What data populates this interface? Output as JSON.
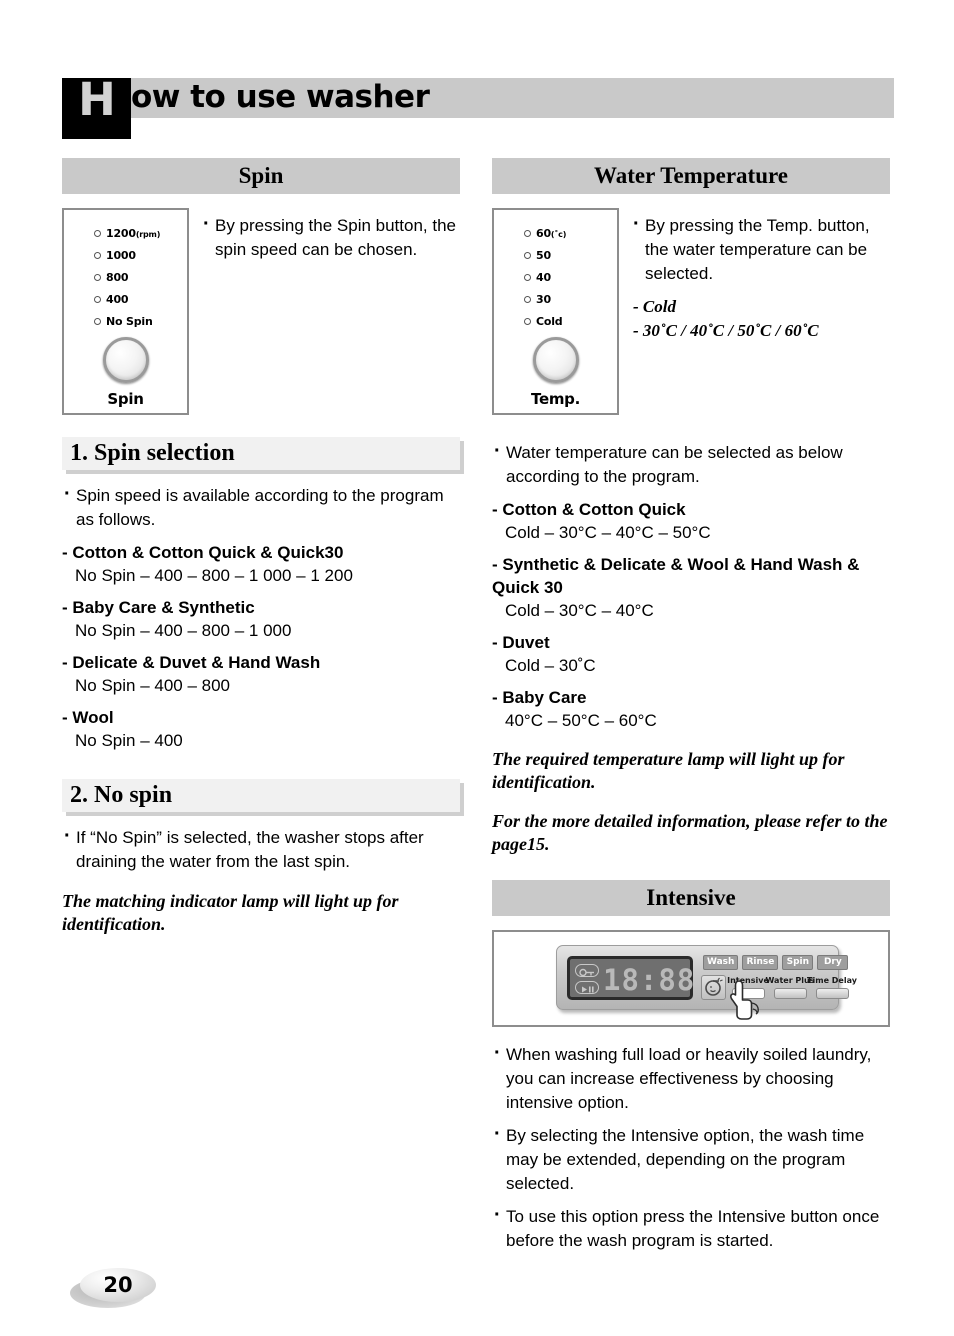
{
  "header": {
    "dropcap": "H",
    "title": "ow to use washer"
  },
  "left_column": {
    "spin_section": {
      "bar_title": "Spin",
      "panel": {
        "leds": [
          {
            "label": "1200",
            "unit": "(rpm)"
          },
          {
            "label": "1000",
            "unit": ""
          },
          {
            "label": "800",
            "unit": ""
          },
          {
            "label": "400",
            "unit": ""
          },
          {
            "label": "No Spin",
            "unit": ""
          }
        ],
        "knob_label": "Spin"
      },
      "note": "By pressing the Spin button, the spin speed can be chosen."
    },
    "heading_1": "1. Spin selection",
    "spin_selection": {
      "bullet": "Spin speed is available according to the program as follows.",
      "items": [
        {
          "title": "Cotton & Cotton Quick & Quick30",
          "value": "No Spin – 400 – 800 – 1 000 – 1 200"
        },
        {
          "title": "Baby Care & Synthetic",
          "value": "No Spin – 400 – 800 – 1 000"
        },
        {
          "title": "Delicate & Duvet & Hand Wash",
          "value": "No Spin – 400 – 800"
        },
        {
          "title": "Wool",
          "value": "No Spin – 400"
        }
      ]
    },
    "heading_2": "2. No spin",
    "no_spin": {
      "bullet": "If “No Spin” is selected, the washer stops after draining the water from the last spin.",
      "italic_note": "The matching indicator lamp will light up for identification."
    }
  },
  "right_column": {
    "temp_section": {
      "bar_title": "Water Temperature",
      "panel": {
        "leds": [
          {
            "label": "60",
            "unit": "(˚c)"
          },
          {
            "label": "50",
            "unit": ""
          },
          {
            "label": "40",
            "unit": ""
          },
          {
            "label": "30",
            "unit": ""
          },
          {
            "label": "Cold",
            "unit": ""
          }
        ],
        "knob_label": "Temp."
      },
      "note": "By pressing the Temp. button, the water temperature can be selected.",
      "options": [
        "Cold",
        "30˚C / 40˚C / 50˚C / 60˚C"
      ]
    },
    "temp_selection": {
      "bullet": "Water temperature can be selected as below according to the program.",
      "items": [
        {
          "title": "Cotton & Cotton Quick",
          "value": "Cold – 30°C – 40°C – 50°C"
        },
        {
          "title": "Synthetic & Delicate & Wool & Hand Wash & Quick 30",
          "value": "Cold – 30°C – 40°C"
        },
        {
          "title": "Duvet",
          "value": "Cold – 30˚C"
        },
        {
          "title": "Baby Care",
          "value": "40°C – 50°C – 60°C"
        }
      ],
      "italic_note_1": "The required temperature lamp will light up for identification.",
      "italic_note_2": "For the more detailed information, please refer to the page15."
    },
    "intensive_section": {
      "bar_title": "Intensive",
      "display": {
        "digits": "18:88",
        "mode_chips": [
          "Wash",
          "Rinse",
          "Spin",
          "Dry"
        ],
        "option_buttons": [
          {
            "label": "Intensive",
            "pressed": true
          },
          {
            "label": "Water Plus",
            "pressed": false
          },
          {
            "label": "Time Delay",
            "pressed": false
          }
        ]
      },
      "bullets": [
        "When washing full load or heavily soiled laundry, you can increase effectiveness by choosing intensive option.",
        "By selecting the Intensive option, the wash time may be extended, depending on the program selected.",
        "To use this option press the Intensive button once before the wash program is started."
      ]
    }
  },
  "footer": {
    "page_number": "20"
  },
  "colors": {
    "bar_gray": "#c9c9c9",
    "heading_gray": "#f1f1f1",
    "shadow_gray": "#cfcfcf",
    "panel_border": "#8d8d8d"
  }
}
